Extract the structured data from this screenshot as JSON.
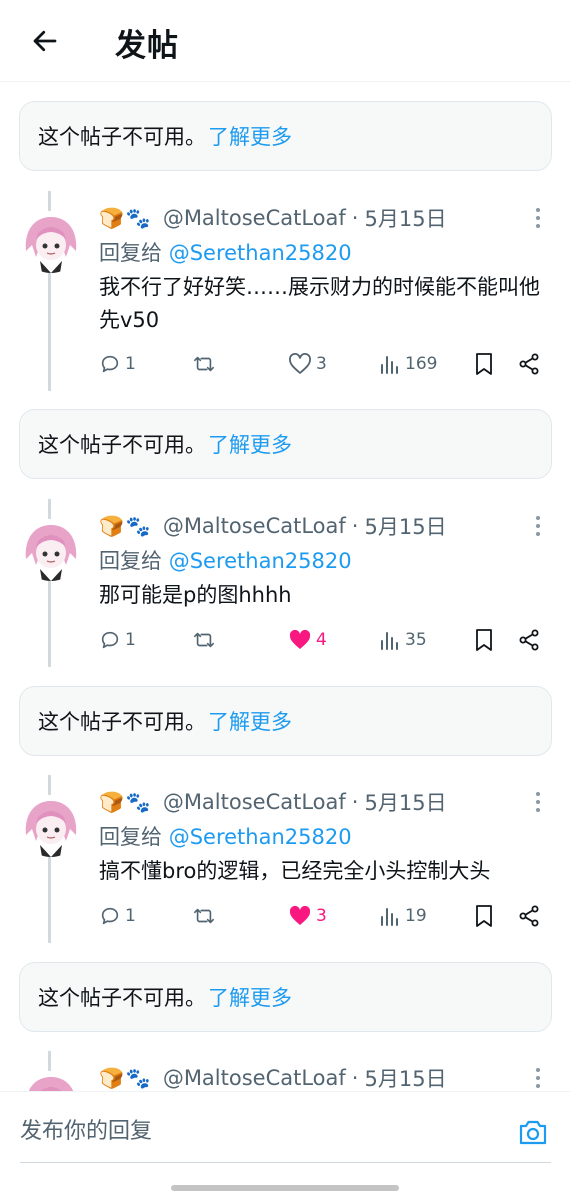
{
  "header": {
    "title": "发帖",
    "back_icon": "arrow-left-icon"
  },
  "unavailable": {
    "text": "这个帖子不可用。",
    "link": "了解更多"
  },
  "replies": [
    {
      "emoji": "🍞🐾",
      "handle": "@MaltoseCatLoaf",
      "sep": "·",
      "date": "5月15日",
      "replying_prefix": "回复给",
      "replying_to": "@Serethan25820",
      "text": "我不行了好好笑……展示财力的时候能不能叫他先v50",
      "stats": {
        "replies": "1",
        "reposts": "",
        "likes": "3",
        "liked": false,
        "views": "169"
      }
    },
    {
      "emoji": "🍞🐾",
      "handle": "@MaltoseCatLoaf",
      "sep": "·",
      "date": "5月15日",
      "replying_prefix": "回复给",
      "replying_to": "@Serethan25820",
      "text": "那可能是p的图hhhh",
      "stats": {
        "replies": "1",
        "reposts": "",
        "likes": "4",
        "liked": true,
        "views": "35"
      }
    },
    {
      "emoji": "🍞🐾",
      "handle": "@MaltoseCatLoaf",
      "sep": "·",
      "date": "5月15日",
      "replying_prefix": "回复给",
      "replying_to": "@Serethan25820",
      "text": "搞不懂bro的逻辑，已经完全小头控制大头",
      "stats": {
        "replies": "1",
        "reposts": "",
        "likes": "3",
        "liked": true,
        "views": "19"
      }
    },
    {
      "emoji": "🍞🐾",
      "handle": "@MaltoseCatLoaf",
      "sep": "·",
      "date": "5月15日"
    }
  ],
  "composer": {
    "placeholder": "发布你的回复",
    "camera_icon": "camera-icon"
  },
  "colors": {
    "accent": "#1d9bf0",
    "like": "#f91880",
    "muted": "#536471"
  }
}
